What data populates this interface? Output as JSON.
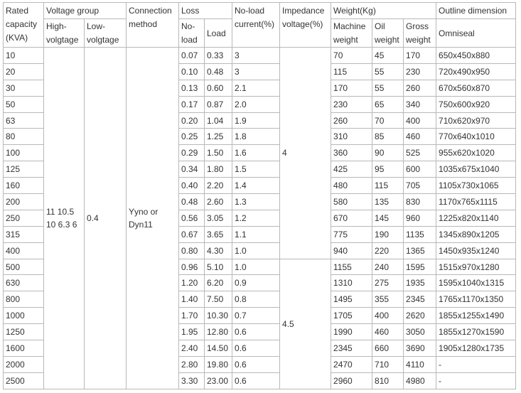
{
  "headers": {
    "rated_capacity": "Rated capacity (KVA)",
    "voltage_group": "Voltage group",
    "high_voltage": "High-volgtage",
    "low_voltage": "Low-volgtage",
    "connection_method": "Connection method",
    "loss": "Loss",
    "no_load": "No-load",
    "load": "Load",
    "no_load_current": "No-load current(%)",
    "impedance_voltage": "Impedance voltage(%)",
    "weight": "Weight(Kg)",
    "machine_weight": "Machine weight",
    "oil_weight": "Oil weight",
    "gross_weight": "Gross weight",
    "outline_dimension": "Outline dimension",
    "omniseal": "Omniseal"
  },
  "merged": {
    "high_voltage_value": "11 10.5 10 6.3 6",
    "low_voltage_value": "0.4",
    "connection_value": "Yyno or Dyn11",
    "impedance_group1": "4",
    "impedance_group2": "4.5"
  },
  "rows": [
    {
      "capacity": "10",
      "no_load": "0.07",
      "load": "0.33",
      "current": "3",
      "machine": "70",
      "oil": "45",
      "gross": "170",
      "dimension": "650x450x880"
    },
    {
      "capacity": "20",
      "no_load": "0.10",
      "load": "0.48",
      "current": "3",
      "machine": "115",
      "oil": "55",
      "gross": "230",
      "dimension": "720x490x950"
    },
    {
      "capacity": "30",
      "no_load": "0.13",
      "load": "0.60",
      "current": "2.1",
      "machine": "170",
      "oil": "55",
      "gross": "260",
      "dimension": "670x560x870"
    },
    {
      "capacity": "50",
      "no_load": "0.17",
      "load": "0.87",
      "current": "2.0",
      "machine": "230",
      "oil": "65",
      "gross": "340",
      "dimension": "750x600x920"
    },
    {
      "capacity": "63",
      "no_load": "0.20",
      "load": "1.04",
      "current": "1.9",
      "machine": "260",
      "oil": "70",
      "gross": "400",
      "dimension": "710x620x970"
    },
    {
      "capacity": "80",
      "no_load": "0.25",
      "load": "1.25",
      "current": "1.8",
      "machine": "310",
      "oil": "85",
      "gross": "460",
      "dimension": "770x640x1010"
    },
    {
      "capacity": "100",
      "no_load": "0.29",
      "load": "1.50",
      "current": "1.6",
      "machine": "360",
      "oil": "90",
      "gross": "525",
      "dimension": "955x620x1020"
    },
    {
      "capacity": "125",
      "no_load": "0.34",
      "load": "1.80",
      "current": "1.5",
      "machine": "425",
      "oil": "95",
      "gross": "600",
      "dimension": "1035x675x1040"
    },
    {
      "capacity": "160",
      "no_load": "0.40",
      "load": "2.20",
      "current": "1.4",
      "machine": "480",
      "oil": "115",
      "gross": "705",
      "dimension": "1105x730x1065"
    },
    {
      "capacity": "200",
      "no_load": "0.48",
      "load": "2.60",
      "current": "1.3",
      "machine": "580",
      "oil": "135",
      "gross": "830",
      "dimension": "1170x765x1115"
    },
    {
      "capacity": "250",
      "no_load": "0.56",
      "load": "3.05",
      "current": "1.2",
      "machine": "670",
      "oil": "145",
      "gross": "960",
      "dimension": "1225x820x1140"
    },
    {
      "capacity": "315",
      "no_load": "0.67",
      "load": "3.65",
      "current": "1.1",
      "machine": "775",
      "oil": "190",
      "gross": "1135",
      "dimension": "1345x890x1205"
    },
    {
      "capacity": "400",
      "no_load": "0.80",
      "load": "4.30",
      "current": "1.0",
      "machine": "940",
      "oil": "220",
      "gross": "1365",
      "dimension": "1450x935x1240"
    },
    {
      "capacity": "500",
      "no_load": "0.96",
      "load": "5.10",
      "current": "1.0",
      "machine": "1155",
      "oil": "240",
      "gross": "1595",
      "dimension": "1515x970x1280"
    },
    {
      "capacity": "630",
      "no_load": "1.20",
      "load": "6.20",
      "current": "0.9",
      "machine": "1310",
      "oil": "275",
      "gross": "1935",
      "dimension": "1595x1040x1315"
    },
    {
      "capacity": "800",
      "no_load": "1.40",
      "load": "7.50",
      "current": "0.8",
      "machine": "1495",
      "oil": "355",
      "gross": "2345",
      "dimension": "1765x1170x1350"
    },
    {
      "capacity": "1000",
      "no_load": "1.70",
      "load": "10.30",
      "current": "0.7",
      "machine": "1705",
      "oil": "400",
      "gross": "2620",
      "dimension": "1855x1255x1490"
    },
    {
      "capacity": "1250",
      "no_load": "1.95",
      "load": "12.80",
      "current": "0.6",
      "machine": "1990",
      "oil": "460",
      "gross": "3050",
      "dimension": "1855x1270x1590"
    },
    {
      "capacity": "1600",
      "no_load": "2.40",
      "load": "14.50",
      "current": "0.6",
      "machine": "2345",
      "oil": "660",
      "gross": "3690",
      "dimension": "1905x1280x1735"
    },
    {
      "capacity": "2000",
      "no_load": "2.80",
      "load": "19.80",
      "current": "0.6",
      "machine": "2470",
      "oil": "710",
      "gross": "4110",
      "dimension": "-"
    },
    {
      "capacity": "2500",
      "no_load": "3.30",
      "load": "23.00",
      "current": "0.6",
      "machine": "2960",
      "oil": "810",
      "gross": "4980",
      "dimension": "-"
    }
  ]
}
